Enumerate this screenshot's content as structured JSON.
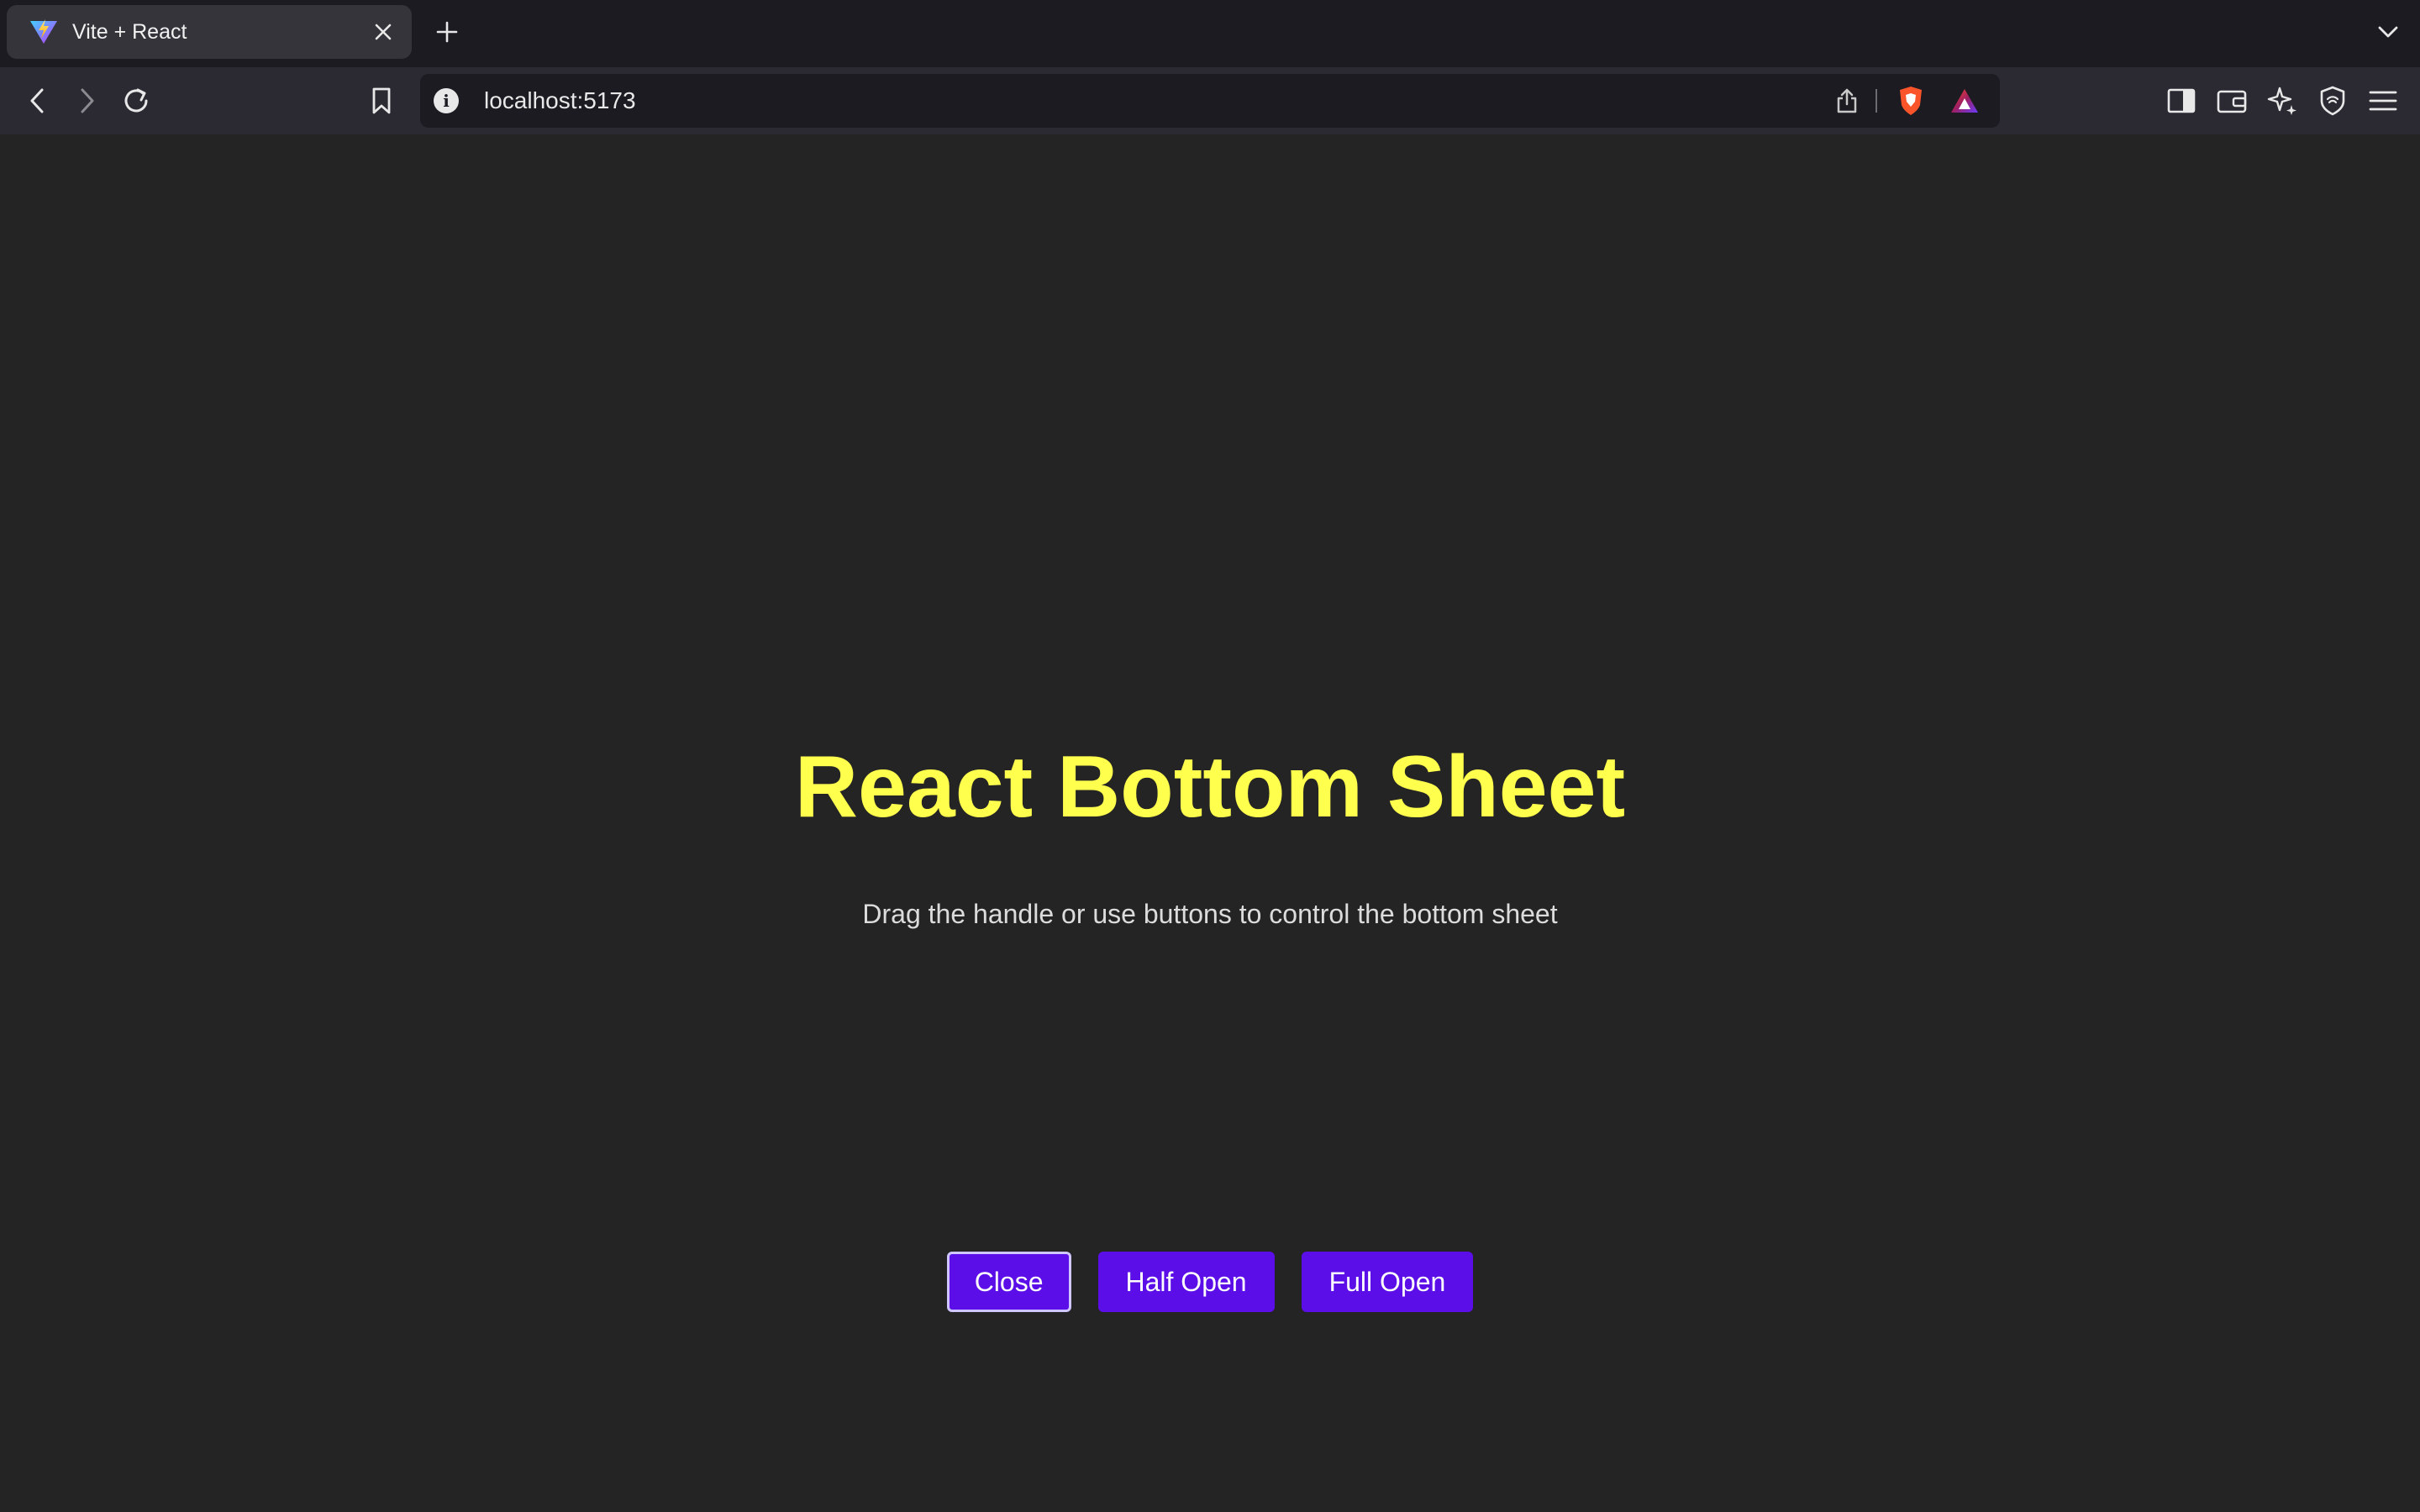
{
  "browser": {
    "tab": {
      "title": "Vite + React",
      "favicon": "vite-logo-icon"
    },
    "url": "localhost:5173",
    "colors": {
      "tabstrip": "#1c1b22",
      "toolbar": "#2b2a33",
      "urlbar": "#1c1b22"
    }
  },
  "page": {
    "title": "React Bottom Sheet",
    "subtitle": "Drag the handle or use buttons to control the bottom sheet",
    "buttons": [
      {
        "label": "Close"
      },
      {
        "label": "Half Open"
      },
      {
        "label": "Full Open"
      }
    ],
    "colors": {
      "background": "#242424",
      "title": "#ffff4d",
      "button": "#5b0ee8"
    }
  }
}
